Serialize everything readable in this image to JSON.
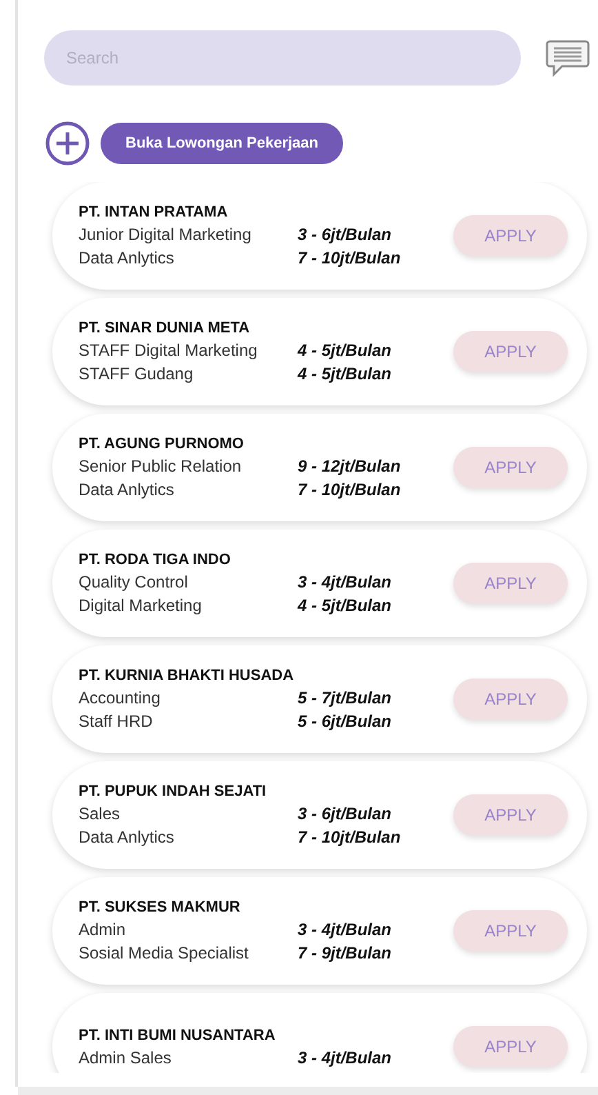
{
  "search": {
    "placeholder": "Search"
  },
  "open_job_button": {
    "label": "Buka Lowongan Pekerjaan"
  },
  "companies": [
    {
      "name": "PT. INTAN PRATAMA",
      "jobs": [
        {
          "title": "Junior Digital Marketing",
          "salary": "3 - 6jt/Bulan"
        },
        {
          "title": "Data Anlytics",
          "salary": "7 - 10jt/Bulan"
        }
      ],
      "action": "APPLY"
    },
    {
      "name": "PT. SINAR DUNIA META",
      "jobs": [
        {
          "title": "STAFF Digital Marketing",
          "salary": "4 - 5jt/Bulan"
        },
        {
          "title": "STAFF Gudang",
          "salary": "4 - 5jt/Bulan"
        }
      ],
      "action": "APPLY"
    },
    {
      "name": "PT. AGUNG PURNOMO",
      "jobs": [
        {
          "title": "Senior Public Relation",
          "salary": "9 - 12jt/Bulan"
        },
        {
          "title": "Data Anlytics",
          "salary": "7 - 10jt/Bulan"
        }
      ],
      "action": "APPLY"
    },
    {
      "name": "PT. RODA TIGA INDO",
      "jobs": [
        {
          "title": "Quality Control",
          "salary": "3 - 4jt/Bulan"
        },
        {
          "title": "Digital Marketing",
          "salary": "4 - 5jt/Bulan"
        }
      ],
      "action": "APPLY"
    },
    {
      "name": "PT. KURNIA BHAKTI HUSADA",
      "jobs": [
        {
          "title": "Accounting",
          "salary": "5 - 7jt/Bulan"
        },
        {
          "title": "Staff HRD",
          "salary": "5 - 6jt/Bulan"
        }
      ],
      "action": "APPLY"
    },
    {
      "name": "PT. PUPUK INDAH SEJATI",
      "jobs": [
        {
          "title": "Sales",
          "salary": "3 - 6jt/Bulan"
        },
        {
          "title": "Data Anlytics",
          "salary": "7 - 10jt/Bulan"
        }
      ],
      "action": "APPLY"
    },
    {
      "name": "PT. SUKSES MAKMUR",
      "jobs": [
        {
          "title": "Admin",
          "salary": "3 - 4jt/Bulan"
        },
        {
          "title": "Sosial Media Specialist",
          "salary": "7 - 9jt/Bulan"
        }
      ],
      "action": "APPLY"
    },
    {
      "name": "PT. INTI BUMI NUSANTARA",
      "jobs": [
        {
          "title": "Admin Sales",
          "salary": "3 - 4jt/Bulan"
        }
      ],
      "action": "APPLY"
    }
  ]
}
